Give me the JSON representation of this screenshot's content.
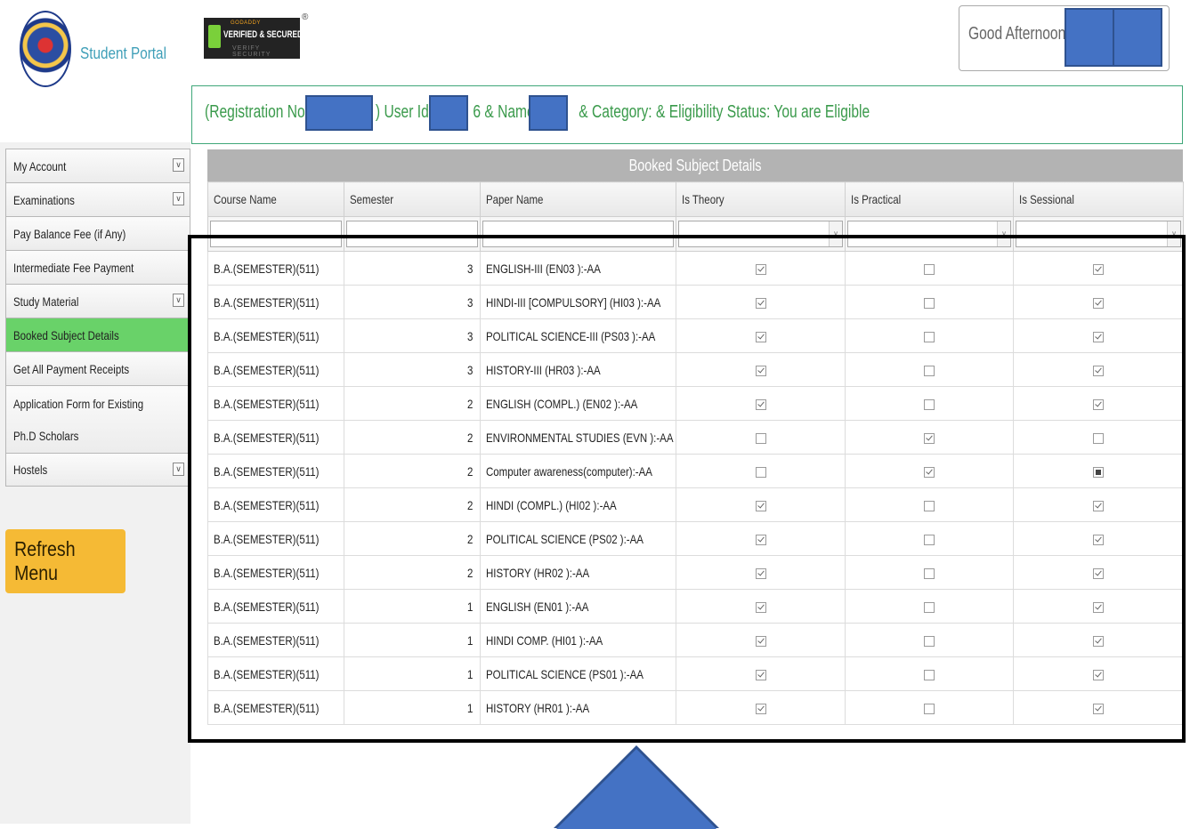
{
  "portal": {
    "name": "Student Portal"
  },
  "badge": {
    "line1": "GODADDY",
    "line2": "VERIFIED & SECURED",
    "line3": "VERIFY SECURITY",
    "reg": "®"
  },
  "header": {
    "greeting": "Good Afternoon,"
  },
  "info": {
    "reg_label": "(Registration No:",
    "userid_label": ") User Id:",
    "name_label": "6 & Name:",
    "rest": "& Category: & Eligibility Status: You are Eligible"
  },
  "menu": [
    {
      "label": "My Account",
      "has_dropdown": true
    },
    {
      "label": "Examinations",
      "has_dropdown": true
    },
    {
      "label": "Pay Balance Fee (if Any)",
      "has_dropdown": false
    },
    {
      "label": "Intermediate Fee Payment",
      "has_dropdown": false
    },
    {
      "label": "Study Material",
      "has_dropdown": true
    },
    {
      "label": "Booked Subject Details",
      "has_dropdown": false,
      "active": true
    },
    {
      "label": "Get All Payment Receipts",
      "has_dropdown": false
    },
    {
      "label": "Application Form for Existing Ph.D Scholars",
      "has_dropdown": false
    },
    {
      "label": "Hostels",
      "has_dropdown": true
    }
  ],
  "refresh_label": "Refresh Menu",
  "grid": {
    "title": "Booked Subject Details",
    "columns": [
      "Course Name",
      "Semester",
      "Paper Name",
      "Is Theory",
      "Is Practical",
      "Is Sessional"
    ],
    "rows": [
      {
        "course": "B.A.(SEMESTER)(511)",
        "semester": "3",
        "paper": "ENGLISH-III (EN03 ):-AA",
        "theory": "checked",
        "practical": "unchecked",
        "sessional": "checked"
      },
      {
        "course": "B.A.(SEMESTER)(511)",
        "semester": "3",
        "paper": "HINDI-III [COMPULSORY] (HI03 ):-AA",
        "theory": "checked",
        "practical": "unchecked",
        "sessional": "checked"
      },
      {
        "course": "B.A.(SEMESTER)(511)",
        "semester": "3",
        "paper": "POLITICAL SCIENCE-III (PS03 ):-AA",
        "theory": "checked",
        "practical": "unchecked",
        "sessional": "checked"
      },
      {
        "course": "B.A.(SEMESTER)(511)",
        "semester": "3",
        "paper": "HISTORY-III (HR03 ):-AA",
        "theory": "checked",
        "practical": "unchecked",
        "sessional": "checked"
      },
      {
        "course": "B.A.(SEMESTER)(511)",
        "semester": "2",
        "paper": "ENGLISH (COMPL.) (EN02 ):-AA",
        "theory": "checked",
        "practical": "unchecked",
        "sessional": "checked"
      },
      {
        "course": "B.A.(SEMESTER)(511)",
        "semester": "2",
        "paper": "ENVIRONMENTAL STUDIES (EVN ):-AA",
        "theory": "unchecked",
        "practical": "checked",
        "sessional": "unchecked"
      },
      {
        "course": "B.A.(SEMESTER)(511)",
        "semester": "2",
        "paper": "Computer awareness(computer):-AA",
        "theory": "unchecked",
        "practical": "checked",
        "sessional": "mixed"
      },
      {
        "course": "B.A.(SEMESTER)(511)",
        "semester": "2",
        "paper": "HINDI (COMPL.) (HI02 ):-AA",
        "theory": "checked",
        "practical": "unchecked",
        "sessional": "checked"
      },
      {
        "course": "B.A.(SEMESTER)(511)",
        "semester": "2",
        "paper": "POLITICAL SCIENCE (PS02 ):-AA",
        "theory": "checked",
        "practical": "unchecked",
        "sessional": "checked"
      },
      {
        "course": "B.A.(SEMESTER)(511)",
        "semester": "2",
        "paper": "HISTORY (HR02 ):-AA",
        "theory": "checked",
        "practical": "unchecked",
        "sessional": "checked"
      },
      {
        "course": "B.A.(SEMESTER)(511)",
        "semester": "1",
        "paper": "ENGLISH (EN01 ):-AA",
        "theory": "checked",
        "practical": "unchecked",
        "sessional": "checked"
      },
      {
        "course": "B.A.(SEMESTER)(511)",
        "semester": "1",
        "paper": "HINDI COMP. (HI01 ):-AA",
        "theory": "checked",
        "practical": "unchecked",
        "sessional": "checked"
      },
      {
        "course": "B.A.(SEMESTER)(511)",
        "semester": "1",
        "paper": "POLITICAL SCIENCE (PS01 ):-AA",
        "theory": "checked",
        "practical": "unchecked",
        "sessional": "checked"
      },
      {
        "course": "B.A.(SEMESTER)(511)",
        "semester": "1",
        "paper": "HISTORY (HR01 ):-AA",
        "theory": "checked",
        "practical": "unchecked",
        "sessional": "checked"
      }
    ]
  },
  "colors": {
    "active_menu": "#69d269",
    "refresh_button": "#f5ba35",
    "info_text": "#3a9a4b",
    "redaction": "#4472c4",
    "grid_title_bg": "#b3b3b3"
  }
}
